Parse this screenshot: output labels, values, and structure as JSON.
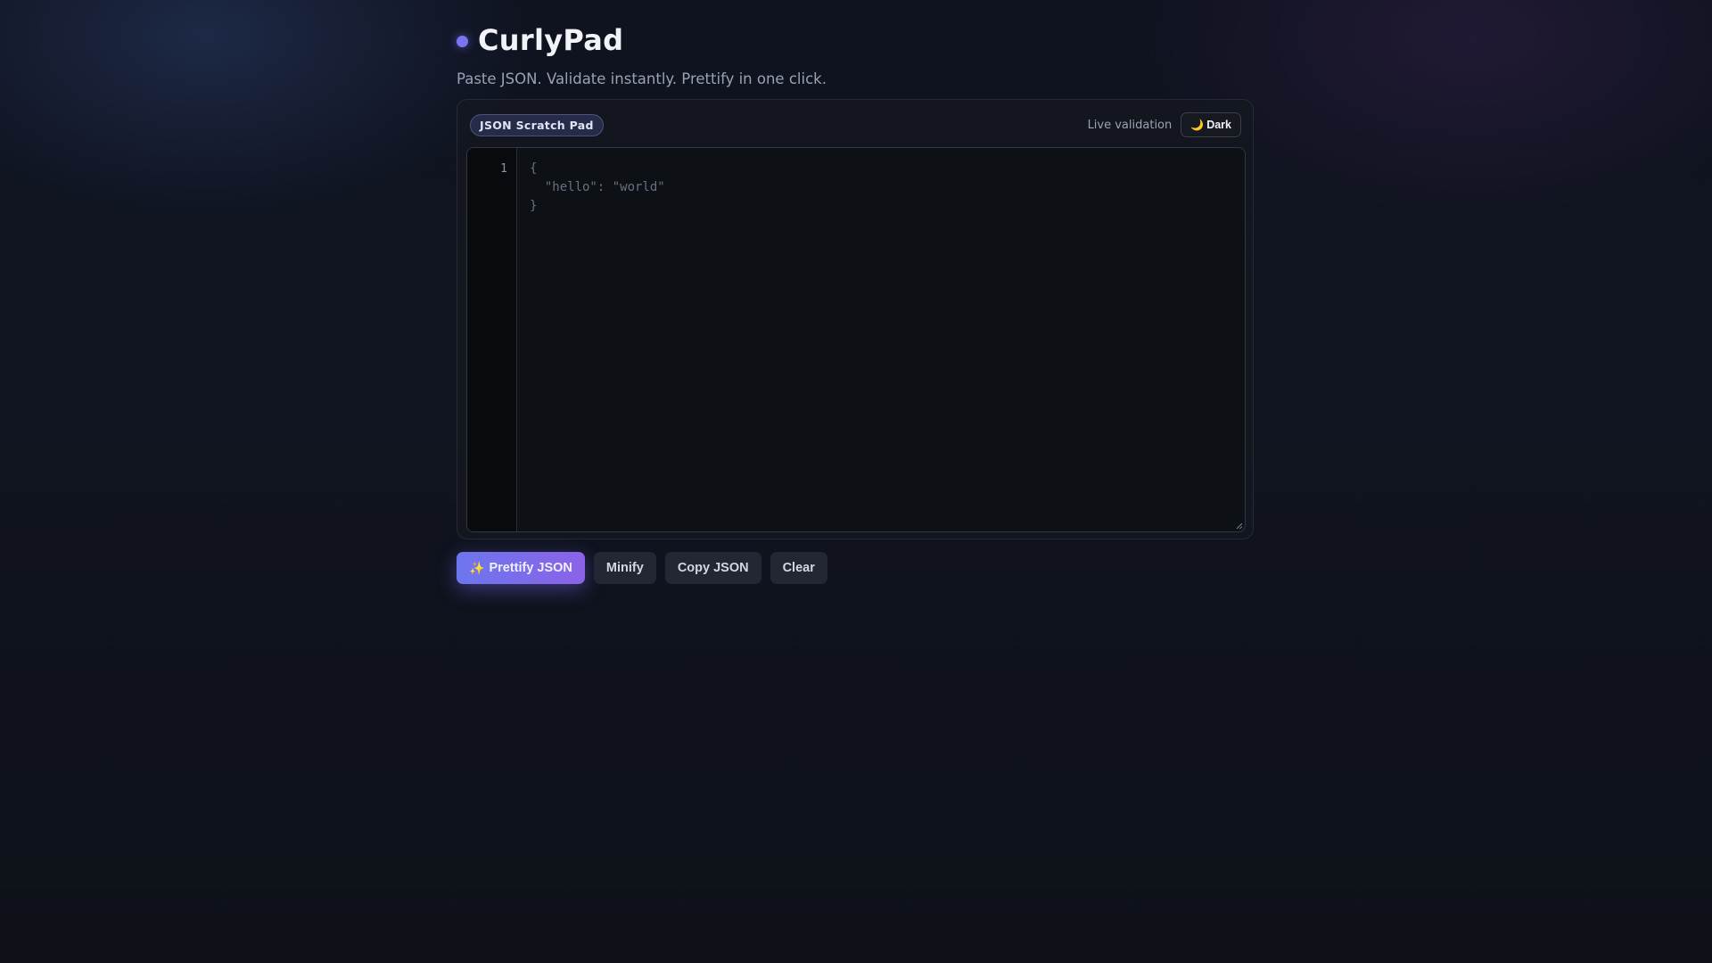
{
  "app": {
    "title": "CurlyPad",
    "tagline": "Paste JSON. Validate instantly. Prettify in one click."
  },
  "card": {
    "pill_label": "JSON Scratch Pad",
    "live_label": "Live validation",
    "theme_button": {
      "icon": "moon-icon",
      "icon_glyph": "🌙",
      "label": "Dark"
    }
  },
  "editor": {
    "line_numbers": [
      "1"
    ],
    "value": "",
    "placeholder": "{\n  \"hello\": \"world\"\n}"
  },
  "actions": {
    "prettify": {
      "icon": "sparkle-icon",
      "icon_glyph": "✨",
      "label": "Prettify JSON"
    },
    "minify_label": "Minify",
    "copy_label": "Copy JSON",
    "clear_label": "Clear"
  },
  "colors": {
    "accent": "#7b74f0",
    "accent_gradient_start": "#6d76ee",
    "accent_gradient_end": "#8b62e8",
    "background": "#0f1320",
    "editor_background": "#0d1015"
  }
}
